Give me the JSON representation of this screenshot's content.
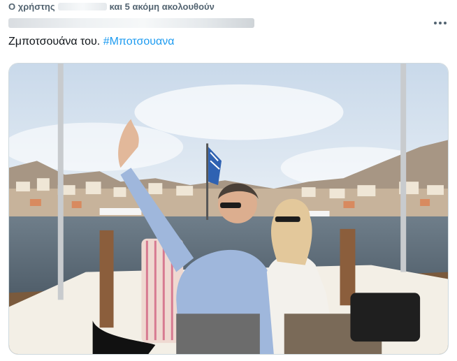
{
  "social_context": {
    "prefix": "Ο χρήστης",
    "suffix": "και 5 ακόμη ακολουθούν"
  },
  "tweet": {
    "text": "Ζμποτσουάνα του.",
    "hashtag": "#Μποτσουανα",
    "more_icon": "more-dots-icon"
  },
  "media": {
    "description_icon": "photo",
    "colors": {
      "sky": "#dfe9f3",
      "water": "#5f6f7d",
      "boat": "#f4f1ea",
      "shirt": "#9fb7dc",
      "hashtag": "#1d9bf0"
    }
  }
}
